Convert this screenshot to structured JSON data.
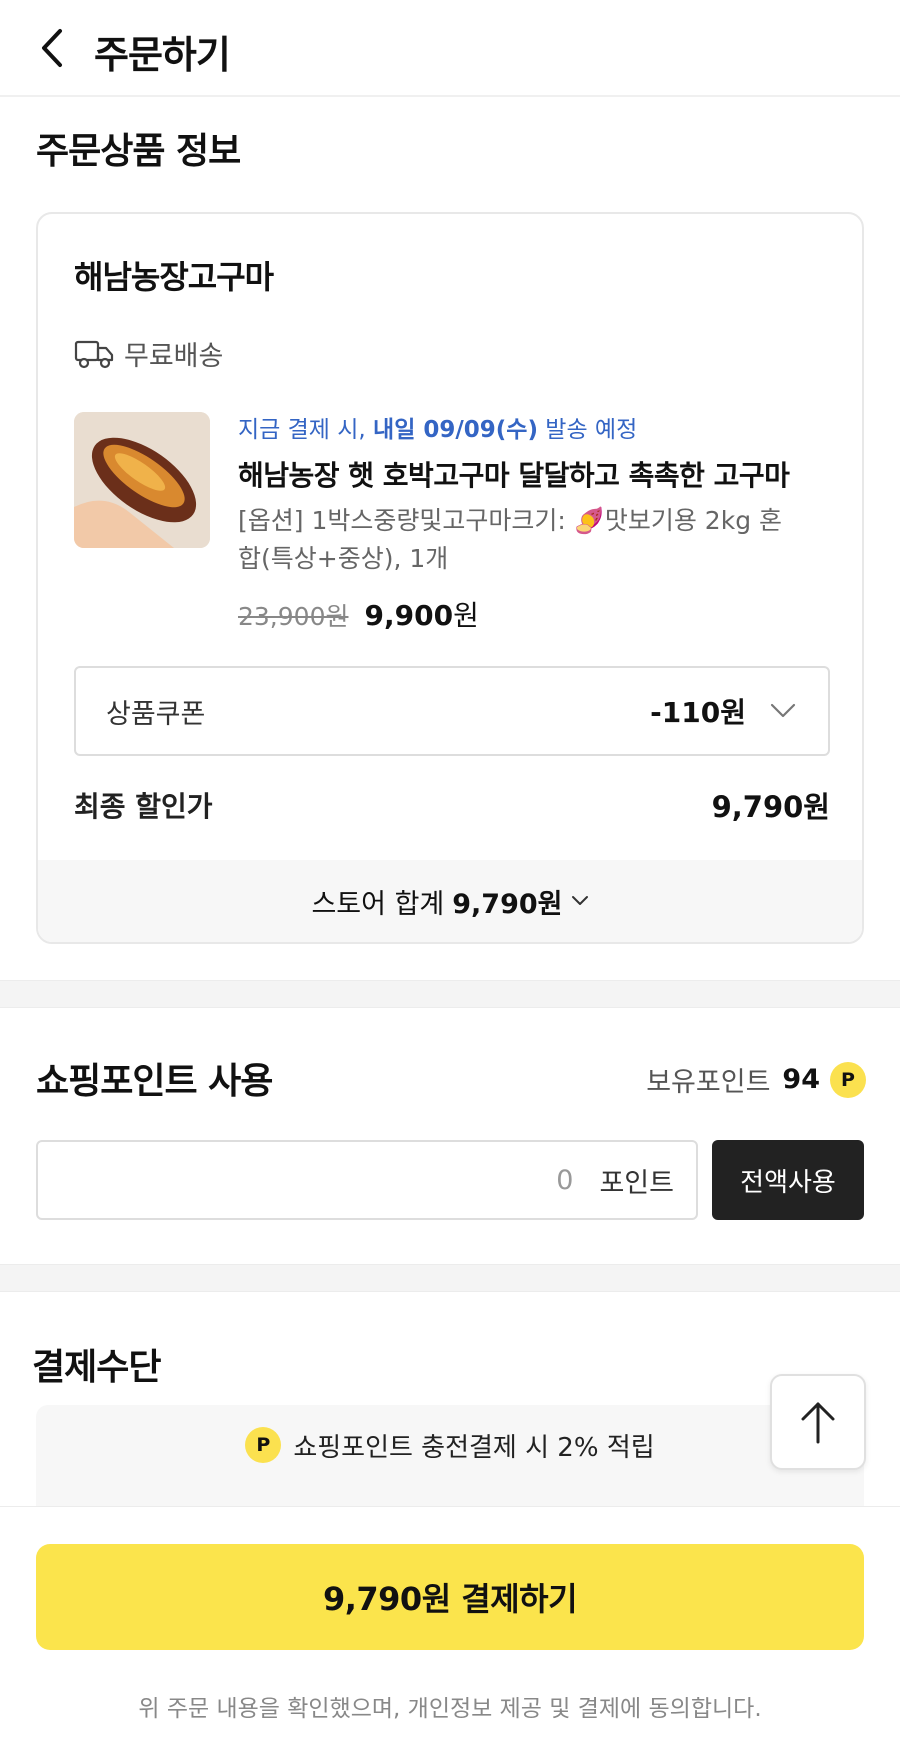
{
  "header": {
    "title": "주문하기",
    "back_icon": "chevron-left-icon"
  },
  "order_section": {
    "title": "주문상품 정보",
    "store": {
      "name": "해남농장고구마",
      "shipping": "무료배송",
      "ship_note_prefix": "지금 결제 시,",
      "ship_note_date": "내일 09/09(수)",
      "ship_note_suffix": "발송 예정",
      "product_name": "해남농장 햇 호박고구마 달달하고 촉촉한 고구마",
      "option_line1": "[옵션] 1박스중량및고구마크기: 🍠맛보기용 2kg 혼",
      "option_line2": "합(특상+중상), 1개",
      "price_original": "23,900원",
      "price_now": "9,900",
      "price_unit": "원",
      "coupon_label": "상품쿠폰",
      "coupon_value": "-110원",
      "final_label": "최종 할인가",
      "final_value": "9,790원",
      "store_total_label": "스토어 합계",
      "store_total_value": "9,790원"
    }
  },
  "points_section": {
    "title": "쇼핑포인트 사용",
    "balance_label": "보유포인트",
    "balance_value": "94",
    "badge": "P",
    "input_value": "0",
    "input_unit": "포인트",
    "use_all_label": "전액사용"
  },
  "payment_section": {
    "title": "결제수단",
    "banner_badge": "P",
    "banner_text": "쇼핑포인트 충전결제 시 2% 적립"
  },
  "bottom": {
    "pay_button": "9,790원 결제하기",
    "agree_note": "위 주문 내용을 확인했으며, 개인정보 제공 및 결제에 동의합니다."
  },
  "colors": {
    "accent_yellow": "#fbe44c",
    "link_blue": "#3465c4",
    "dark_button": "#222222"
  }
}
